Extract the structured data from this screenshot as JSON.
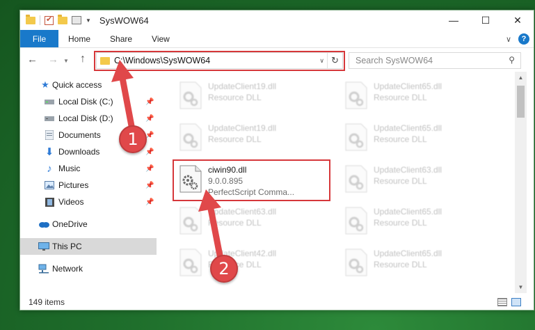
{
  "window": {
    "title": "SysWOW64",
    "controls": {
      "minimize": "—",
      "maximize": "☐",
      "close": "✕"
    }
  },
  "ribbon": {
    "tabs": [
      "File",
      "Home",
      "Share",
      "View"
    ],
    "help": "?"
  },
  "address_bar": {
    "path": "C:\\Windows\\SysWOW64",
    "refresh_icon": "↻"
  },
  "search": {
    "placeholder": "Search SysWOW64"
  },
  "sidebar": {
    "items": [
      {
        "label": "Quick access",
        "icon": "star-icon"
      },
      {
        "label": "Local Disk (C:)",
        "icon": "drive-icon",
        "pinned": true
      },
      {
        "label": "Local Disk (D:)",
        "icon": "drive-icon",
        "pinned": true
      },
      {
        "label": "Documents",
        "icon": "documents-icon",
        "pinned": true
      },
      {
        "label": "Downloads",
        "icon": "downloads-icon",
        "pinned": true
      },
      {
        "label": "Music",
        "icon": "music-icon",
        "pinned": true
      },
      {
        "label": "Pictures",
        "icon": "pictures-icon",
        "pinned": true
      },
      {
        "label": "Videos",
        "icon": "videos-icon",
        "pinned": true
      },
      {
        "label": "OneDrive",
        "icon": "cloud-icon"
      },
      {
        "label": "This PC",
        "icon": "monitor-icon",
        "selected": true
      },
      {
        "label": "Network",
        "icon": "network-icon"
      }
    ]
  },
  "files": [
    {
      "name": "UpdateClient19.dll",
      "desc": "Resource DLL",
      "blurred": true
    },
    {
      "name": "UpdateClient65.dll",
      "desc": "Resource DLL",
      "blurred": true
    },
    {
      "name": "UpdateClient19.dll",
      "desc": "Resource DLL",
      "blurred": true
    },
    {
      "name": "UpdateClient65.dll",
      "desc": "Resource DLL",
      "blurred": true
    },
    {
      "name": "ciwin90.dll",
      "desc": "9.0.0.895",
      "desc2": "PerfectScript Comma...",
      "blurred": false
    },
    {
      "name": "UpdateClient63.dll",
      "desc": "Resource DLL",
      "blurred": true
    },
    {
      "name": "UpdateClient63.dll",
      "desc": "Resource DLL",
      "blurred": true
    },
    {
      "name": "UpdateClient65.dll",
      "desc": "Resource DLL",
      "blurred": true
    },
    {
      "name": "UpdateClient42.dll",
      "desc": "Resource DLL",
      "blurred": true
    },
    {
      "name": "UpdateClient65.dll",
      "desc": "Resource DLL",
      "blurred": true
    }
  ],
  "status": {
    "item_count": "149 items"
  },
  "annotations": {
    "step1": "1",
    "step2": "2",
    "color": "#e0484a"
  }
}
